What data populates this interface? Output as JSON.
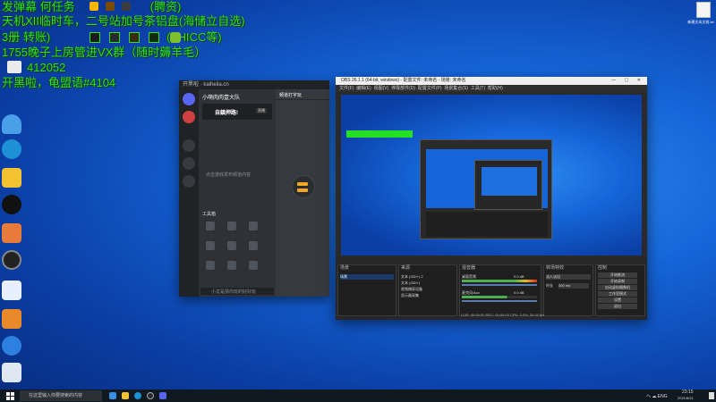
{
  "overlay": {
    "line1": "发弹幕 何任务",
    "line1_tail": "(聘资)",
    "line2": "天机XII临时车，二号站加号茶铝盘(海储立自选)",
    "line3": "3册 转账)",
    "line3_tail": "(THICC等)",
    "line4": "1755晚子上房管进VX群（随时薅羊毛）",
    "line5": "412052",
    "line6": "开黑啦，龟盟语#4104"
  },
  "discord": {
    "window_title": "开黑啦 · kaiheila.cn",
    "server_name": "小萌肉肉壹大队",
    "banner_label": "自鎮押路!",
    "section_label": "工具箱",
    "chat_header": "频道打字玩",
    "empty_text": "点击游戏发布频道内容",
    "status_hint": "小龙是猜你玩的好好玩",
    "badge": "直播"
  },
  "obs": {
    "title": "OBS 26.1.1 (64-bit, windows) - 配置文件: 未命名 - 场景: 未命名",
    "menu": [
      "文件(F)",
      "编辑(E)",
      "视图(V)",
      "停靠部件(D)",
      "配置文件(P)",
      "场景集合(S)",
      "工具(T)",
      "帮助(H)"
    ],
    "scenes_header": "场景",
    "sources_header": "来源",
    "mixer_header": "混音器",
    "transitions_header": "转场特效",
    "controls_header": "控制",
    "scene_item": "场景",
    "sources": [
      "文本 (GDI+) 2",
      "文本 (GDI+)",
      "视频捕获设备",
      "显示器采集"
    ],
    "mixer_tracks": [
      "桌面音频",
      "麦克风/Aux"
    ],
    "mixer_values": [
      "0.0 dB",
      "0.0 dB"
    ],
    "transition_value": "淡入淡出",
    "duration_label": "时长",
    "duration_value": "300 ms",
    "controls": [
      "开始推流",
      "开始录制",
      "启动虚拟摄像机",
      "工作室模式",
      "设置",
      "退出"
    ],
    "status": "LIVE: 00:00:00   REC: 00:00:00   CPU: 3.0%, 30.00 fps"
  },
  "desktop_icons": [
    "recycle-bin-icon",
    "network-icon",
    "edge-icon",
    "game-icon",
    "qq-icon",
    "wechat-icon",
    "app-icon",
    "media-icon",
    "chat-icon",
    "help-icon",
    "k-app-icon",
    "monitor-icon"
  ],
  "taskbar": {
    "search_placeholder": "在这里输入你要搜索的内容",
    "tray_text": "へ ☁ ENG",
    "time": "23:15",
    "date": "2021/6/21"
  },
  "top_right_icon_label": "新建文本文档.txt"
}
